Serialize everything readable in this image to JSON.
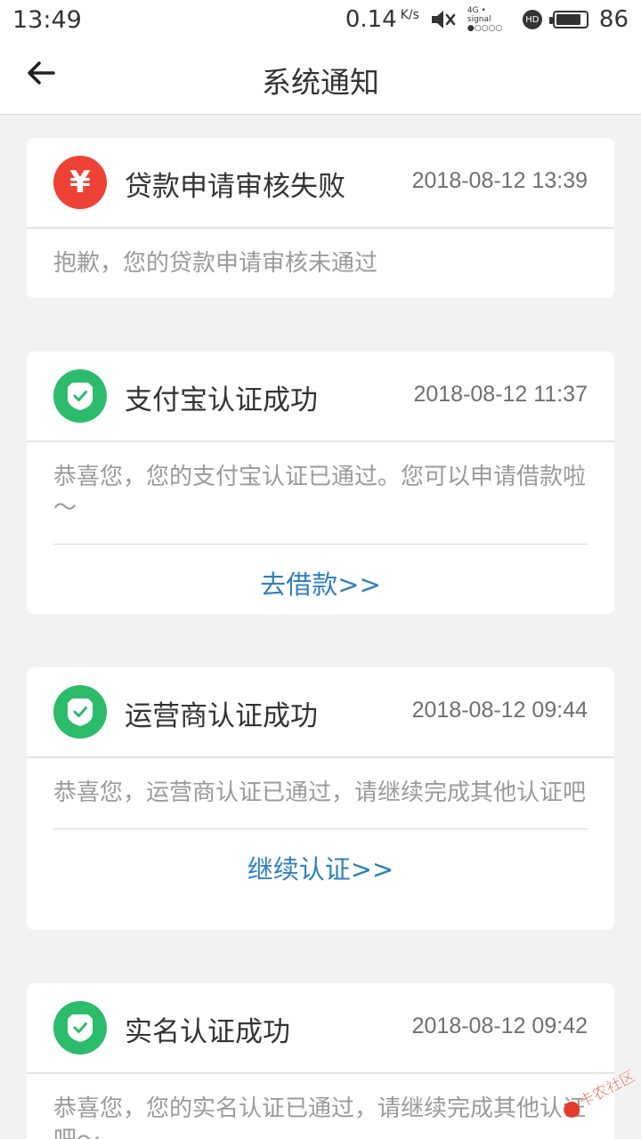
{
  "status": {
    "time": "13:49",
    "speed": "0.14",
    "speed_unit": "K/s",
    "network_top": "4G • signal",
    "network_bottom": "●○○○○",
    "hd": "HD",
    "battery_level": "86",
    "battery_fraction": 0.86
  },
  "header": {
    "title": "系统通知"
  },
  "notifications": [
    {
      "icon": "yen-icon",
      "title": "贷款申请审核失败",
      "time": "2018-08-12 13:39",
      "message": "抱歉，您的贷款申请审核未通过"
    },
    {
      "icon": "shield-check-icon",
      "title": "支付宝认证成功",
      "time": "2018-08-12 11:37",
      "message": "恭喜您，您的支付宝认证已通过。您可以申请借款啦～",
      "link": "去借款>>"
    },
    {
      "icon": "shield-check-icon",
      "title": "运营商认证成功",
      "time": "2018-08-12 09:44",
      "message": "恭喜您，运营商认证已通过，请继续完成其他认证吧",
      "link": "继续认证>>"
    },
    {
      "icon": "shield-check-icon",
      "title": "实名认证成功",
      "time": "2018-08-12 09:42",
      "message": "恭喜您，您的实名认证已通过，请继续完成其他认证吧～"
    }
  ],
  "watermark": {
    "text": "卡农社区"
  },
  "colors": {
    "error_badge": "#ee4236",
    "success_badge": "#2cbb6a",
    "link": "#2f7fc0",
    "background": "#f2f2f2"
  }
}
